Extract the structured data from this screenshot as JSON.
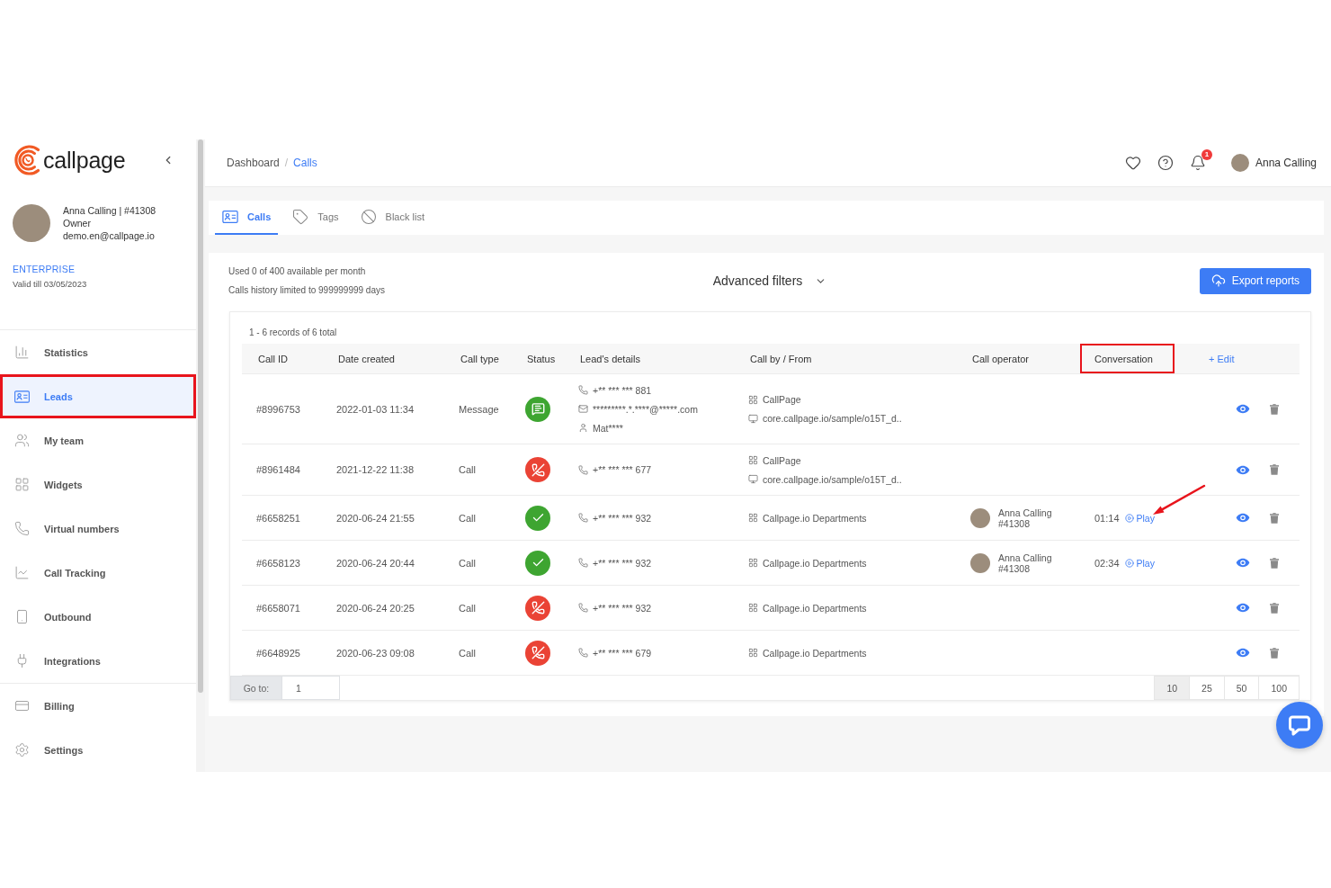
{
  "sidebar": {
    "brand": "callpage",
    "profile": {
      "name": "Anna Calling | #41308",
      "role": "Owner",
      "email": "demo.en@callpage.io"
    },
    "plan": {
      "name": "ENTERPRISE",
      "validity": "Valid till 03/05/2023"
    },
    "nav_main": [
      {
        "label": "Statistics",
        "selected": false,
        "highlighted": false
      },
      {
        "label": "Leads",
        "selected": true,
        "highlighted": true
      },
      {
        "label": "My team",
        "selected": false,
        "highlighted": false
      },
      {
        "label": "Widgets",
        "selected": false,
        "highlighted": false
      },
      {
        "label": "Virtual numbers",
        "selected": false,
        "highlighted": false
      },
      {
        "label": "Call Tracking",
        "selected": false,
        "highlighted": false
      },
      {
        "label": "Outbound",
        "selected": false,
        "highlighted": false
      },
      {
        "label": "Integrations",
        "selected": false,
        "highlighted": false
      }
    ],
    "nav_bottom": [
      {
        "label": "Billing",
        "selected": false,
        "highlighted": false
      },
      {
        "label": "Settings",
        "selected": false,
        "highlighted": false
      }
    ]
  },
  "header": {
    "breadcrumb": {
      "separator": "/",
      "items": [
        {
          "label": "Dashboard",
          "current": false
        },
        {
          "label": "Calls",
          "current": true
        }
      ]
    },
    "notifications": "1",
    "user": "Anna Calling"
  },
  "tabs": [
    {
      "label": "Calls",
      "selected": true
    },
    {
      "label": "Tags",
      "selected": false
    },
    {
      "label": "Black list",
      "selected": false
    }
  ],
  "usage": [
    "Used 0 of 400 available per month",
    "Calls history limited to 999999999 days"
  ],
  "filters": {
    "label": "Advanced filters",
    "expanded": false
  },
  "export_button": "Export reports",
  "table": {
    "summary": "1 - 6 records of 6 total",
    "columns": [
      {
        "label": "Call ID",
        "highlighted": false
      },
      {
        "label": "Date created",
        "highlighted": false
      },
      {
        "label": "Call type",
        "highlighted": false
      },
      {
        "label": "Status",
        "highlighted": false
      },
      {
        "label": "Lead's details",
        "highlighted": false
      },
      {
        "label": "Call by / From",
        "highlighted": false
      },
      {
        "label": "Call operator",
        "highlighted": false
      },
      {
        "label": "Conversation",
        "highlighted": true
      }
    ],
    "edit_label": "+ Edit",
    "rows": [
      {
        "call_id": "#8996753",
        "date": "2022-01-03 11:34",
        "call_type": "Message",
        "status": {
          "kind": "message"
        },
        "lead": [
          {
            "kind": "phone",
            "text": "+** *** *** 881"
          },
          {
            "kind": "email",
            "text": "*********.*.****@*****.com"
          },
          {
            "kind": "name",
            "text": "Mat****"
          }
        ],
        "call_by": [
          {
            "kind": "widget",
            "text": "CallPage"
          },
          {
            "kind": "page",
            "text": "core.callpage.io/sample/o15T_d.."
          }
        ]
      },
      {
        "call_id": "#8961484",
        "date": "2021-12-22 11:38",
        "call_type": "Call",
        "status": {
          "kind": "missed"
        },
        "lead": [
          {
            "kind": "phone",
            "text": "+** *** *** 677"
          }
        ],
        "call_by": [
          {
            "kind": "widget",
            "text": "CallPage"
          },
          {
            "kind": "page",
            "text": "core.callpage.io/sample/o15T_d.."
          }
        ]
      },
      {
        "call_id": "#6658251",
        "date": "2020-06-24 21:55",
        "call_type": "Call",
        "status": {
          "kind": "answered"
        },
        "lead": [
          {
            "kind": "phone",
            "text": "+** *** *** 932"
          }
        ],
        "call_by": [
          {
            "kind": "widget",
            "text": "Callpage.io Departments"
          }
        ],
        "operator": {
          "name": "Anna Calling",
          "id": "#41308"
        },
        "conversation": {
          "duration": "01:14",
          "play": "Play",
          "pointed": true
        }
      },
      {
        "call_id": "#6658123",
        "date": "2020-06-24 20:44",
        "call_type": "Call",
        "status": {
          "kind": "answered"
        },
        "lead": [
          {
            "kind": "phone",
            "text": "+** *** *** 932"
          }
        ],
        "call_by": [
          {
            "kind": "widget",
            "text": "Callpage.io Departments"
          }
        ],
        "operator": {
          "name": "Anna Calling",
          "id": "#41308"
        },
        "conversation": {
          "duration": "02:34",
          "play": "Play",
          "pointed": false
        }
      },
      {
        "call_id": "#6658071",
        "date": "2020-06-24 20:25",
        "call_type": "Call",
        "status": {
          "kind": "missed"
        },
        "lead": [
          {
            "kind": "phone",
            "text": "+** *** *** 932"
          }
        ],
        "call_by": [
          {
            "kind": "widget",
            "text": "Callpage.io Departments"
          }
        ]
      },
      {
        "call_id": "#6648925",
        "date": "2020-06-23 09:08",
        "call_type": "Call",
        "status": {
          "kind": "missed"
        },
        "lead": [
          {
            "kind": "phone",
            "text": "+** *** *** 679"
          }
        ],
        "call_by": [
          {
            "kind": "widget",
            "text": "Callpage.io Departments"
          }
        ]
      }
    ]
  },
  "pagination": {
    "goto_label": "Go to:",
    "goto_value": "1",
    "page_sizes": [
      {
        "label": "10",
        "selected": true
      },
      {
        "label": "25",
        "selected": false
      },
      {
        "label": "50",
        "selected": false
      },
      {
        "label": "100",
        "selected": false
      }
    ]
  }
}
